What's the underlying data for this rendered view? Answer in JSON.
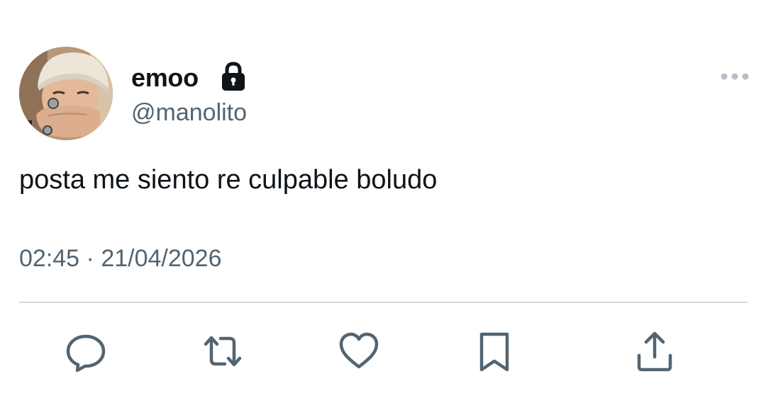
{
  "tweet": {
    "author": {
      "display_name": "emoo",
      "handle": "@manolito",
      "protected_icon": "lock-icon",
      "avatar": "profile-photo"
    },
    "text": "posta me siento re culpable boludo",
    "time": "02:45",
    "separator": "·",
    "date": "21/04/2026",
    "menu_icon": "more-horizontal-icon",
    "actions": [
      {
        "name": "reply",
        "icon": "reply-icon"
      },
      {
        "name": "retweet",
        "icon": "retweet-icon"
      },
      {
        "name": "like",
        "icon": "heart-icon"
      },
      {
        "name": "bookmark",
        "icon": "bookmark-icon"
      },
      {
        "name": "share",
        "icon": "share-icon"
      }
    ]
  },
  "colors": {
    "text_primary": "#0f1419",
    "text_secondary": "#536471",
    "divider": "#cfd9de",
    "icon": "#536471",
    "background": "#ffffff"
  }
}
